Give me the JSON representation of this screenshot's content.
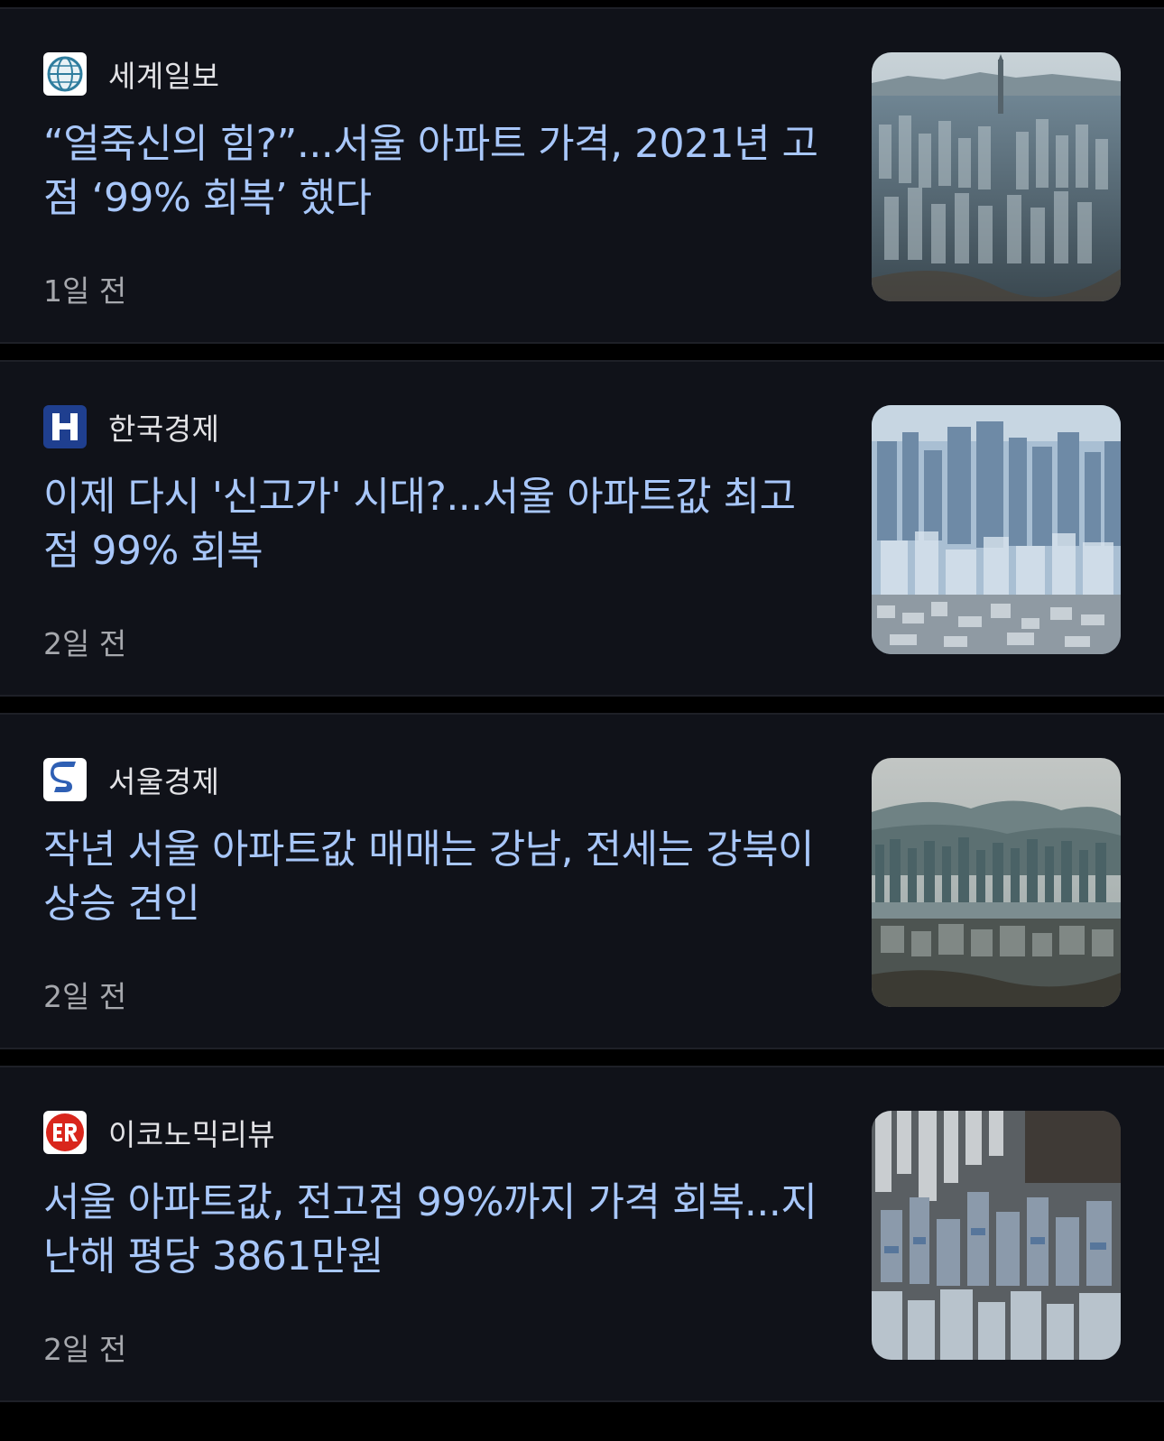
{
  "feed": {
    "items": [
      {
        "source": "세계일보",
        "logo_icon": "segye-globe-logo-icon",
        "headline": "“얼죽신의 힘?”...서울 아파트 가격, 2021년 고점 ‘99% 회복’ 했다",
        "time": "1일 전",
        "thumbnail": "seoul-tower-cityscape-thumbnail"
      },
      {
        "source": "한국경제",
        "logo_icon": "hankyung-h-logo-icon",
        "headline": "이제 다시 '신고가' 시대?...서울 아파트값 최고점 99% 회복",
        "time": "2일 전",
        "thumbnail": "dense-apartments-thumbnail"
      },
      {
        "source": "서울경제",
        "logo_icon": "sedaily-s-logo-icon",
        "headline": "작년 서울 아파트값 매매는 강남, 전세는 강북이 상승 견인",
        "time": "2일 전",
        "thumbnail": "hazy-mountain-city-thumbnail"
      },
      {
        "source": "이코노믹리뷰",
        "logo_icon": "er-logo-icon",
        "headline": "서울 아파트값, 전고점 99%까지 가격 회복...지난해 평당 3861만원",
        "time": "2일 전",
        "thumbnail": "aerial-apartments-thumbnail"
      }
    ]
  },
  "colors": {
    "page_background": "#000000",
    "card_background": "#101219",
    "headline": "#a8c7fa",
    "source_text": "#e3e3e6",
    "time_text": "#a6a8ad"
  }
}
